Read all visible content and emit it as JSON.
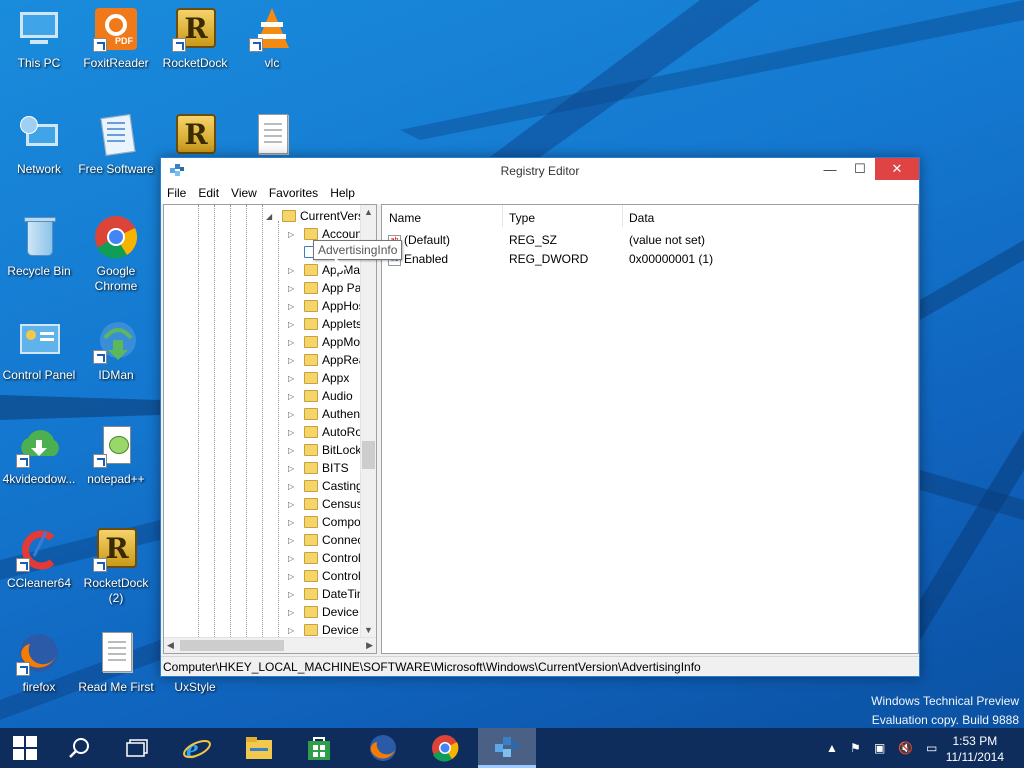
{
  "desktop": {
    "icons": [
      {
        "label": "This PC",
        "icon": "this-pc-icon"
      },
      {
        "label": "FoxitReader",
        "icon": "foxit-reader-icon"
      },
      {
        "label": "RocketDock",
        "icon": "rocketdock-icon"
      },
      {
        "label": "vlc",
        "icon": "vlc-icon"
      },
      {
        "label": "Network",
        "icon": "network-icon"
      },
      {
        "label": "Free Software",
        "icon": "free-software-icon"
      },
      {
        "label": "Recycle Bin",
        "icon": "recycle-bin-icon"
      },
      {
        "label": "Google\nChrome",
        "icon": "chrome-icon"
      },
      {
        "label": "Control Panel",
        "icon": "control-panel-icon"
      },
      {
        "label": "IDMan",
        "icon": "idman-icon"
      },
      {
        "label": "4kvideodow...",
        "icon": "4kvideodownloader-icon"
      },
      {
        "label": "notepad++",
        "icon": "notepadpp-icon"
      },
      {
        "label": "CCleaner64",
        "icon": "ccleaner-icon"
      },
      {
        "label": "RocketDock\n(2)",
        "icon": "rocketdock-icon"
      },
      {
        "label": "firefox",
        "icon": "firefox-icon"
      },
      {
        "label": "Read Me First",
        "icon": "text-file-icon"
      },
      {
        "label": "UxStyle",
        "icon": "uxstyle-icon"
      }
    ]
  },
  "window": {
    "title": "Registry Editor",
    "controls": {
      "minimize": "—",
      "maximize": "☐",
      "close": "✕"
    },
    "menu": [
      "File",
      "Edit",
      "View",
      "Favorites",
      "Help"
    ],
    "tree": {
      "parent": "CurrentVers",
      "items": [
        "Accoun",
        "",
        "AppMa",
        "App Pat",
        "AppHos",
        "Applets",
        "AppMo",
        "AppRea",
        "Appx",
        "Audio",
        "Authen",
        "AutoRo",
        "BitLock",
        "BITS",
        "Casting",
        "Census",
        "Compo",
        "Connec",
        "Control",
        "Control",
        "DateTin",
        "Device I",
        "Device I"
      ]
    },
    "values": {
      "headers": {
        "name": "Name",
        "type": "Type",
        "data": "Data"
      },
      "rows": [
        {
          "name": "(Default)",
          "type": "REG_SZ",
          "data": "(value not set)"
        },
        {
          "name": "Enabled",
          "type": "REG_DWORD",
          "data": "0x00000001 (1)"
        }
      ]
    },
    "status": "Computer\\HKEY_LOCAL_MACHINE\\SOFTWARE\\Microsoft\\Windows\\CurrentVersion\\AdvertisingInfo",
    "tooltip": "AdvertisingInfo"
  },
  "watermark": {
    "line1": "Windows Technical Preview",
    "line2": "Evaluation copy. Build 9888"
  },
  "taskbar": {
    "items": [
      "start-icon",
      "search-icon",
      "task-view-icon",
      "ie-icon",
      "file-explorer-icon",
      "store-icon",
      "firefox-icon",
      "chrome-icon",
      "regedit-icon"
    ],
    "tray_icons": [
      "chevron-up-icon",
      "action-center-flag-icon",
      "network-icon",
      "volume-muted-icon",
      "keyboard-icon"
    ],
    "time": "1:53 PM",
    "date": "11/11/2014"
  },
  "colors": {
    "close_button": "#e04343",
    "taskbar": "#0e2d5c",
    "folder": "#f5d56a"
  }
}
